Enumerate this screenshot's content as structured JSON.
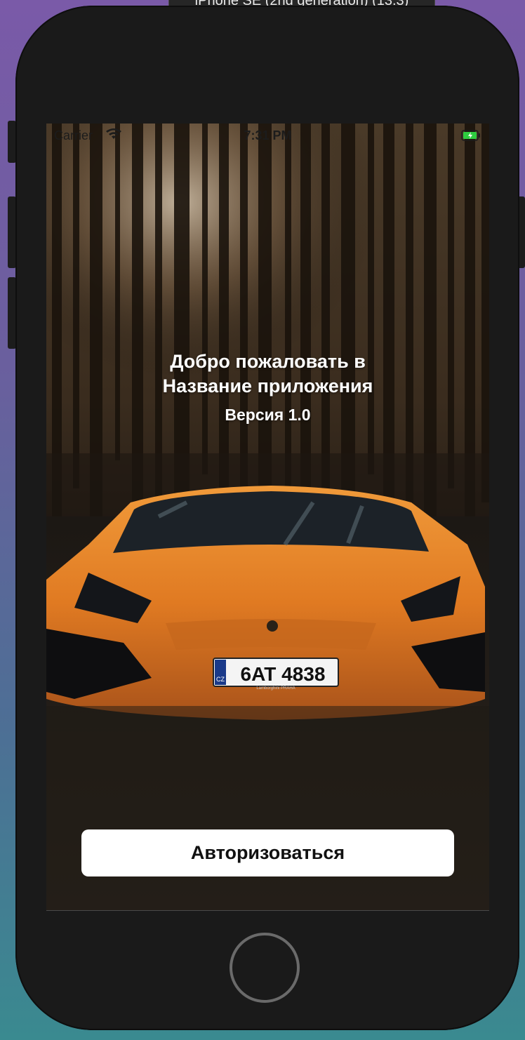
{
  "simulator": {
    "title": "iPhone SE (2nd generation) (13.3)"
  },
  "status_bar": {
    "carrier": "Carrier",
    "time": "7:31 PM",
    "wifi_icon": "wifi-icon",
    "battery_icon": "battery-charging-icon",
    "battery_color": "#2ecc40"
  },
  "welcome": {
    "line1": "Добро пожаловать в",
    "line2": "Название приложения",
    "version": "Версия 1.0"
  },
  "background": {
    "description_icon": "forest-car-photo",
    "accent": "#e8862a",
    "license_plate": {
      "country": "CZ",
      "number": "6AT 4838",
      "dealer": "Lamborghini PRAHA"
    }
  },
  "auth": {
    "button_label": "Авторизоваться"
  },
  "device": {
    "home_button_icon": "home-button-icon"
  }
}
